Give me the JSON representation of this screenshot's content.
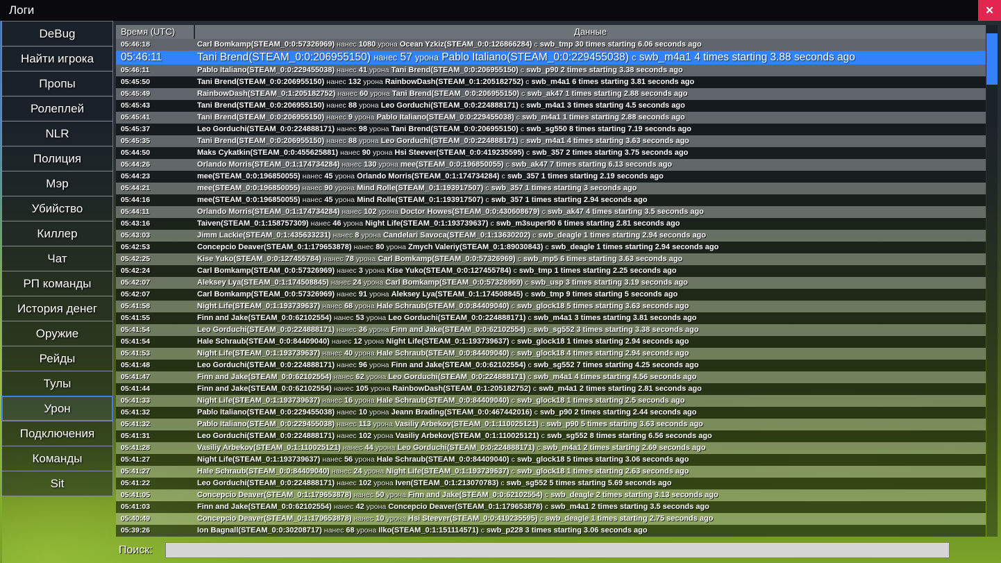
{
  "window": {
    "title": "Логи",
    "close_glyph": "✕"
  },
  "colors": {
    "selection": "#3381fb",
    "close_button": "#e32650",
    "scrollbar_thumb": "#3381fb"
  },
  "sidebar": {
    "items": [
      {
        "key": "debug",
        "label": "DeBug",
        "selected": false
      },
      {
        "key": "find-player",
        "label": "Найти игрока",
        "selected": false
      },
      {
        "key": "props",
        "label": "Пропы",
        "selected": false
      },
      {
        "key": "roleplay",
        "label": "Ролеплей",
        "selected": false
      },
      {
        "key": "nlr",
        "label": "NLR",
        "selected": false
      },
      {
        "key": "police",
        "label": "Полиция",
        "selected": false
      },
      {
        "key": "mayor",
        "label": "Мэр",
        "selected": false
      },
      {
        "key": "murder",
        "label": "Убийство",
        "selected": false
      },
      {
        "key": "killer",
        "label": "Киллер",
        "selected": false
      },
      {
        "key": "chat",
        "label": "Чат",
        "selected": false
      },
      {
        "key": "rp-commands",
        "label": "РП команды",
        "selected": false
      },
      {
        "key": "money-history",
        "label": "История денег",
        "selected": false
      },
      {
        "key": "weapons",
        "label": "Оружие",
        "selected": false
      },
      {
        "key": "raids",
        "label": "Рейды",
        "selected": false
      },
      {
        "key": "tools",
        "label": "Тулы",
        "selected": false
      },
      {
        "key": "damage",
        "label": "Урон",
        "selected": true
      },
      {
        "key": "connections",
        "label": "Подключения",
        "selected": false
      },
      {
        "key": "commands",
        "label": "Команды",
        "selected": false
      },
      {
        "key": "sit",
        "label": "Sit",
        "selected": false
      }
    ]
  },
  "table": {
    "columns": {
      "time": "Время (UTC)",
      "data": "Данные"
    },
    "connectors": {
      "dealt": "нанес",
      "damage": "урона",
      "with": "с"
    },
    "selected_index": 1,
    "rows": [
      [
        "05:46:18",
        "Carl Bomkamp(STEAM_0:0:57326969)",
        "1080",
        "Ocean Yzkiz(STEAM_0:0:126866284)",
        "swb_tmp 30 times starting 6.06 seconds ago"
      ],
      [
        "05:46:11",
        "Tani Brend(STEAM_0:0:206955150)",
        "57",
        "Pablo Italiano(STEAM_0:0:229455038)",
        "swb_m4a1 4 times starting 3.88 seconds ago"
      ],
      [
        "05:46:11",
        "Pablo Italiano(STEAM_0:0:229455038)",
        "41",
        "Tani Brend(STEAM_0:0:206955150)",
        "swb_p90 2 times starting 3.38 seconds ago"
      ],
      [
        "05:45:50",
        "Tani Brend(STEAM_0:0:206955150)",
        "132",
        "RainbowDash(STEAM_0:1:205182752)",
        "swb_m4a1 6 times starting 3.81 seconds ago"
      ],
      [
        "05:45:49",
        "RainbowDash(STEAM_0:1:205182752)",
        "60",
        "Tani Brend(STEAM_0:0:206955150)",
        "swb_ak47 1 times starting 2.88 seconds ago"
      ],
      [
        "05:45:43",
        "Tani Brend(STEAM_0:0:206955150)",
        "88",
        "Leo Gorduchi(STEAM_0:0:224888171)",
        "swb_m4a1 3 times starting 4.5 seconds ago"
      ],
      [
        "05:45:41",
        "Tani Brend(STEAM_0:0:206955150)",
        "9",
        "Pablo Italiano(STEAM_0:0:229455038)",
        "swb_m4a1 1 times starting 2.88 seconds ago"
      ],
      [
        "05:45:37",
        "Leo Gorduchi(STEAM_0:0:224888171)",
        "98",
        "Tani Brend(STEAM_0:0:206955150)",
        "swb_sg550 8 times starting 7.19 seconds ago"
      ],
      [
        "05:45:35",
        "Tani Brend(STEAM_0:0:206955150)",
        "88",
        "Leo Gorduchi(STEAM_0:0:224888171)",
        "swb_m4a1 4 times starting 3.63 seconds ago"
      ],
      [
        "05:44:50",
        "Maks Cykatkin(STEAM_0:0:455625881)",
        "90",
        "Hsi Steever(STEAM_0:0:419235595)",
        "swb_357 2 times starting 3.75 seconds ago"
      ],
      [
        "05:44:26",
        "Orlando Morris(STEAM_0:1:174734284)",
        "130",
        "mee(STEAM_0:0:196850055)",
        "swb_ak47 7 times starting 6.13 seconds ago"
      ],
      [
        "05:44:23",
        "mee(STEAM_0:0:196850055)",
        "45",
        "Orlando Morris(STEAM_0:1:174734284)",
        "swb_357 1 times starting 2.19 seconds ago"
      ],
      [
        "05:44:21",
        "mee(STEAM_0:0:196850055)",
        "90",
        "Mind Rolle(STEAM_0:1:193917507)",
        "swb_357 1 times starting 3 seconds ago"
      ],
      [
        "05:44:16",
        "mee(STEAM_0:0:196850055)",
        "45",
        "Mind Rolle(STEAM_0:1:193917507)",
        "swb_357 1 times starting 2.94 seconds ago"
      ],
      [
        "05:44:11",
        "Orlando Morris(STEAM_0:1:174734284)",
        "102",
        "Doctor Howes(STEAM_0:0:430608679)",
        "swb_ak47 4 times starting 3.5 seconds ago"
      ],
      [
        "05:43:16",
        "Taiven(STEAM_0:1:158757309)",
        "46",
        "Night Life(STEAM_0:1:193739637)",
        "swb_m3super90 6 times starting 2.81 seconds ago"
      ],
      [
        "05:43:03",
        "Jimm Lackie(STEAM_0:1:435633231)",
        "8",
        "Candelari Savoca(STEAM_0:1:13630202)",
        "swb_deagle 1 times starting 2.94 seconds ago"
      ],
      [
        "05:42:53",
        "Concepcio Deaver(STEAM_0:1:179653878)",
        "80",
        "Zmych Valeriy(STEAM_0:1:89030843)",
        "swb_deagle 1 times starting 2.94 seconds ago"
      ],
      [
        "05:42:25",
        "Kise Yuko(STEAM_0:0:127455784)",
        "78",
        "Carl Bomkamp(STEAM_0:0:57326969)",
        "swb_mp5 6 times starting 3.63 seconds ago"
      ],
      [
        "05:42:24",
        "Carl Bomkamp(STEAM_0:0:57326969)",
        "3",
        "Kise Yuko(STEAM_0:0:127455784)",
        "swb_tmp 1 times starting 2.25 seconds ago"
      ],
      [
        "05:42:07",
        "Aleksey Lya(STEAM_0:1:174508845)",
        "24",
        "Carl Bomkamp(STEAM_0:0:57326969)",
        "swb_usp 3 times starting 3.19 seconds ago"
      ],
      [
        "05:42:07",
        "Carl Bomkamp(STEAM_0:0:57326969)",
        "91",
        "Aleksey Lya(STEAM_0:1:174508845)",
        "swb_tmp 9 times starting 5 seconds ago"
      ],
      [
        "05:41:58",
        "Night Life(STEAM_0:1:193739637)",
        "68",
        "Hale Schraub(STEAM_0:0:84409040)",
        "swb_glock18 5 times starting 3.63 seconds ago"
      ],
      [
        "05:41:55",
        "Finn and Jake(STEAM_0:0:62102554)",
        "53",
        "Leo Gorduchi(STEAM_0:0:224888171)",
        "swb_m4a1 3 times starting 3.81 seconds ago"
      ],
      [
        "05:41:54",
        "Leo Gorduchi(STEAM_0:0:224888171)",
        "36",
        "Finn and Jake(STEAM_0:0:62102554)",
        "swb_sg552 3 times starting 3.38 seconds ago"
      ],
      [
        "05:41:54",
        "Hale Schraub(STEAM_0:0:84409040)",
        "12",
        "Night Life(STEAM_0:1:193739637)",
        "swb_glock18 1 times starting 2.94 seconds ago"
      ],
      [
        "05:41:53",
        "Night Life(STEAM_0:1:193739637)",
        "40",
        "Hale Schraub(STEAM_0:0:84409040)",
        "swb_glock18 4 times starting 2.94 seconds ago"
      ],
      [
        "05:41:48",
        "Leo Gorduchi(STEAM_0:0:224888171)",
        "96",
        "Finn and Jake(STEAM_0:0:62102554)",
        "swb_sg552 7 times starting 4.25 seconds ago"
      ],
      [
        "05:41:47",
        "Finn and Jake(STEAM_0:0:62102554)",
        "62",
        "Leo Gorduchi(STEAM_0:0:224888171)",
        "swb_m4a1 4 times starting 4.56 seconds ago"
      ],
      [
        "05:41:44",
        "Finn and Jake(STEAM_0:0:62102554)",
        "105",
        "RainbowDash(STEAM_0:1:205182752)",
        "swb_m4a1 2 times starting 2.81 seconds ago"
      ],
      [
        "05:41:33",
        "Night Life(STEAM_0:1:193739637)",
        "16",
        "Hale Schraub(STEAM_0:0:84409040)",
        "swb_glock18 1 times starting 2.5 seconds ago"
      ],
      [
        "05:41:32",
        "Pablo Italiano(STEAM_0:0:229455038)",
        "10",
        "Jeann Brading(STEAM_0:0:467442016)",
        "swb_p90 2 times starting 2.44 seconds ago"
      ],
      [
        "05:41:32",
        "Pablo Italiano(STEAM_0:0:229455038)",
        "113",
        "Vasiliy Arbekov(STEAM_0:1:110025121)",
        "swb_p90 5 times starting 3.63 seconds ago"
      ],
      [
        "05:41:31",
        "Leo Gorduchi(STEAM_0:0:224888171)",
        "102",
        "Vasiliy Arbekov(STEAM_0:1:110025121)",
        "swb_sg552 8 times starting 6.56 seconds ago"
      ],
      [
        "05:41:28",
        "Vasiliy Arbekov(STEAM_0:1:110025121)",
        "44",
        "Leo Gorduchi(STEAM_0:0:224888171)",
        "swb_m4a1 2 times starting 2.69 seconds ago"
      ],
      [
        "05:41:27",
        "Night Life(STEAM_0:1:193739637)",
        "56",
        "Hale Schraub(STEAM_0:0:84409040)",
        "swb_glock18 5 times starting 3.06 seconds ago"
      ],
      [
        "05:41:27",
        "Hale Schraub(STEAM_0:0:84409040)",
        "24",
        "Night Life(STEAM_0:1:193739637)",
        "swb_glock18 1 times starting 2.63 seconds ago"
      ],
      [
        "05:41:22",
        "Leo Gorduchi(STEAM_0:0:224888171)",
        "102",
        "Iven(STEAM_0:1:213070783)",
        "swb_sg552 5 times starting 5.69 seconds ago"
      ],
      [
        "05:41:05",
        "Concepcio Deaver(STEAM_0:1:179653878)",
        "50",
        "Finn and Jake(STEAM_0:0:62102554)",
        "swb_deagle 2 times starting 3.13 seconds ago"
      ],
      [
        "05:41:03",
        "Finn and Jake(STEAM_0:0:62102554)",
        "42",
        "Concepcio Deaver(STEAM_0:1:179653878)",
        "swb_m4a1 2 times starting 3.5 seconds ago"
      ],
      [
        "05:40:49",
        "Concepcio Deaver(STEAM_0:1:179653878)",
        "10",
        "Hsi Steever(STEAM_0:0:419235595)",
        "swb_deagle 1 times starting 2.75 seconds ago"
      ],
      [
        "05:39:26",
        "Ion Bagnall(STEAM_0:0:30208717)",
        "68",
        "Ilko(STEAM_0:1:151114571)",
        "swb_p228 3 times starting 3.06 seconds ago"
      ]
    ]
  },
  "search": {
    "label": "Поиск:",
    "value": ""
  }
}
